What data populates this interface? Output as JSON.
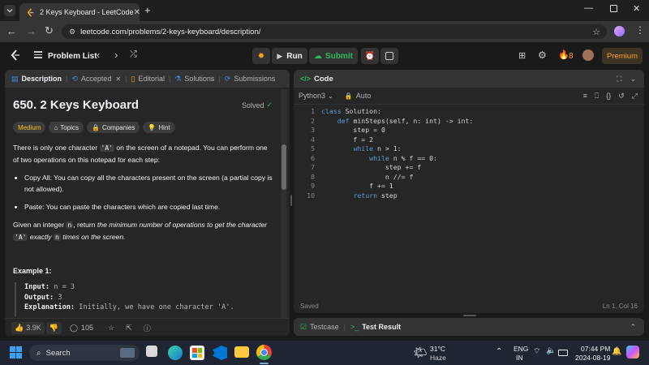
{
  "browser": {
    "tab_title": "2 Keys Keyboard - LeetCode",
    "url": "leetcode.com/problems/2-keys-keyboard/description/"
  },
  "lc": {
    "problem_list": "Problem List",
    "run": "Run",
    "submit": "Submit",
    "streak": "8",
    "premium": "Premium"
  },
  "left_tabs": {
    "description": "Description",
    "accepted": "Accepted",
    "editorial": "Editorial",
    "solutions": "Solutions",
    "submissions": "Submissions"
  },
  "problem": {
    "title": "650. 2 Keys Keyboard",
    "status": "Solved",
    "difficulty": "Medium",
    "tags": [
      "Topics",
      "Companies",
      "Hint"
    ],
    "intro_a": "There is only one character ",
    "intro_char": "'A'",
    "intro_b": " on the screen of a notepad. You can perform one of two operations on this notepad for each step:",
    "bullet1": "Copy All: You can copy all the characters present on the screen (a partial copy is not allowed).",
    "bullet2": "Paste: You can paste the characters which are copied last time.",
    "given_a": "Given an integer ",
    "given_n": "n",
    "given_b": ", return ",
    "given_c": "the minimum number of operations to get the character ",
    "given_char": "'A'",
    "given_d": " exactly ",
    "given_n2": "n",
    "given_e": " times on the screen.",
    "example_title": "Example 1:",
    "ex_input_label": "Input:",
    "ex_input": " n = 3",
    "ex_output_label": "Output:",
    "ex_output": " 3",
    "ex_expl_label": "Explanation:",
    "ex_expl": " Initially, we have one character 'A'."
  },
  "left_footer": {
    "likes": "3.9K",
    "comments": "105"
  },
  "editor": {
    "header": "Code",
    "language": "Python3",
    "mode": "Auto",
    "line_numbers": [
      "1",
      "2",
      "3",
      "4",
      "5",
      "6",
      "7",
      "8",
      "9",
      "10"
    ],
    "status_left": "Saved",
    "status_right": "Ln 1, Col 16"
  },
  "bottom_panel": {
    "testcase": "Testcase",
    "test_result": "Test Result"
  },
  "taskbar": {
    "search": "Search",
    "temp": "31°C",
    "weather": "Haze",
    "lang1": "ENG",
    "lang2": "IN",
    "time": "07:44 PM",
    "date": "2024-08-19"
  },
  "colors": {
    "accent_orange": "#ffa116",
    "success_green": "#2cbb5d",
    "medium_yellow": "#ffc01e",
    "blue_tab": "#3e8de0"
  }
}
